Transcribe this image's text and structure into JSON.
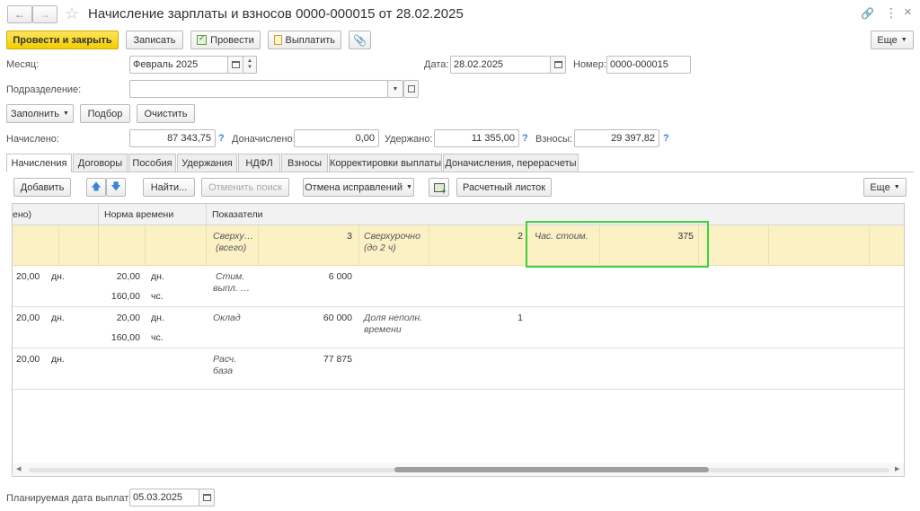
{
  "window": {
    "title": "Начисление зарплаты и взносов 0000-000015 от 28.02.2025"
  },
  "toolbar": {
    "post_close": "Провести и закрыть",
    "save": "Записать",
    "post": "Провести",
    "pay": "Выплатить",
    "more": "Еще"
  },
  "form": {
    "month_label": "Месяц:",
    "month_value": "Февраль 2025",
    "date_label": "Дата:",
    "date_value": "28.02.2025",
    "number_label": "Номер:",
    "number_value": "0000-000015",
    "dept_label": "Подразделение:",
    "dept_value": ""
  },
  "actions": {
    "fill": "Заполнить",
    "select": "Подбор",
    "clear": "Очистить"
  },
  "totals": {
    "accrued_label": "Начислено:",
    "accrued_value": "87 343,75",
    "additional_label": "Доначислено:",
    "additional_value": "0,00",
    "withheld_label": "Удержано:",
    "withheld_value": "11 355,00",
    "contrib_label": "Взносы:",
    "contrib_value": "29 397,82",
    "help": "?"
  },
  "tabs": [
    "Начисления",
    "Договоры",
    "Пособия",
    "Удержания",
    "НДФЛ",
    "Взносы",
    "Корректировки выплаты",
    "Доначисления, перерасчеты"
  ],
  "table_toolbar": {
    "add": "Добавить",
    "find": "Найти...",
    "cancel_search": "Отменить поиск",
    "cancel_fix": "Отмена исправлений",
    "paysheet": "Расчетный листок",
    "more": "Еще"
  },
  "table": {
    "headers": {
      "col1": "ено)",
      "col2": "Норма времени",
      "col3": "Показатели"
    },
    "highlight_row": {
      "ind1_name": "Сверху…",
      "ind1_name2": "(всего)",
      "ind1_value": "3",
      "ind2_name": "Сверхурочно",
      "ind2_name2": "(до 2 ч)",
      "ind2_value": "2",
      "ind3_name": "Час. стоим.",
      "ind3_value": "375"
    },
    "rows": [
      {
        "days": "20,00",
        "days_unit": "дн.",
        "norm_days": "20,00",
        "norm_days_unit": "дн.",
        "norm_hours": "160,00",
        "norm_hours_unit": "чс.",
        "ind1_name": "Стим.",
        "ind1_name2": "выпл. …",
        "ind1_value": "6 000",
        "ind2_name": "",
        "ind2_name2": "",
        "ind2_value": ""
      },
      {
        "days": "20,00",
        "days_unit": "дн.",
        "norm_days": "20,00",
        "norm_days_unit": "дн.",
        "norm_hours": "160,00",
        "norm_hours_unit": "чс.",
        "ind1_name": "Оклад",
        "ind1_name2": "",
        "ind1_value": "60 000",
        "ind2_name": "Доля неполн.",
        "ind2_name2": "времени",
        "ind2_value": "1"
      },
      {
        "days": "20,00",
        "days_unit": "дн.",
        "norm_days": "",
        "norm_days_unit": "",
        "norm_hours": "",
        "norm_hours_unit": "",
        "ind1_name": "Расч.",
        "ind1_name2": "база",
        "ind1_value": "77 875",
        "ind2_name": "",
        "ind2_name2": "",
        "ind2_value": ""
      }
    ]
  },
  "footer": {
    "pay_date_label": "Планируемая дата выплаты:",
    "pay_date_value": "05.03.2025"
  },
  "colors": {
    "highlight_row": "#fbf1c4",
    "header_bg": "#f2f2f2",
    "selection_border": "#3dd13d",
    "accent_yellow": "#f5d000"
  }
}
